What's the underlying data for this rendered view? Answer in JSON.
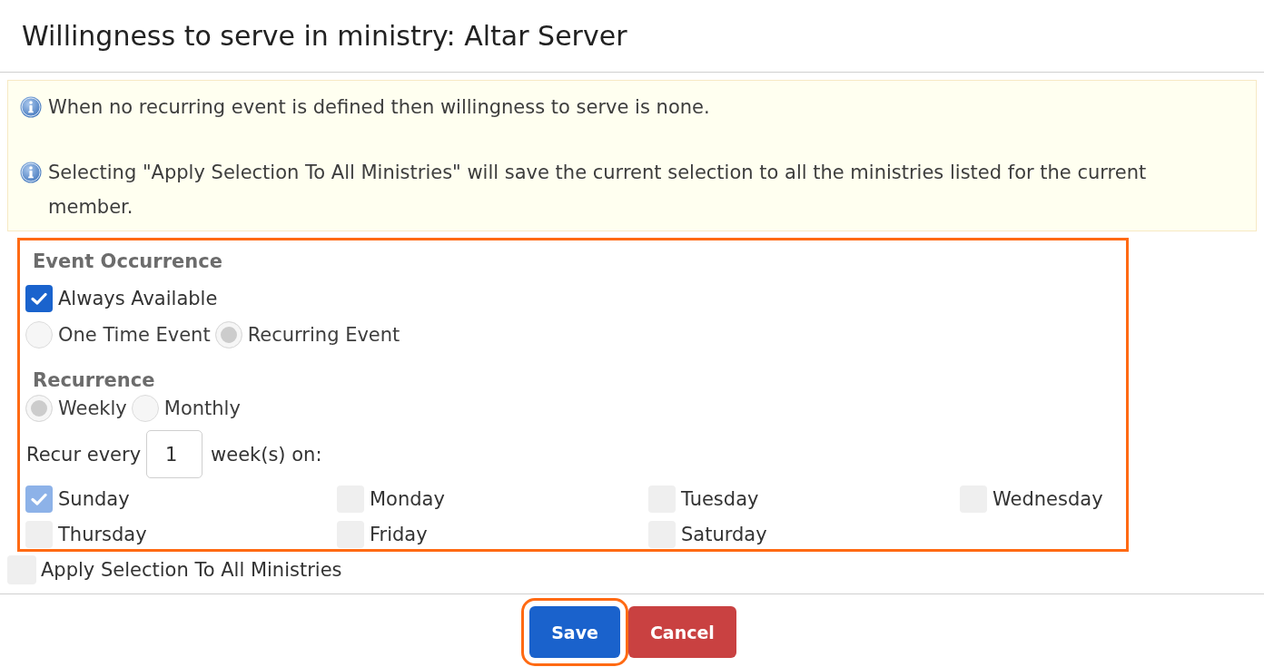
{
  "dialog": {
    "title": "Willingness to serve in ministry: Altar Server"
  },
  "notices": [
    {
      "text": "When no recurring event is defined then willingness to serve is none."
    },
    {
      "text": "Selecting \"Apply Selection To All Ministries\" will save the current selection to all the ministries listed for the current member."
    }
  ],
  "event_panel": {
    "highlighted": true,
    "occurrence": {
      "heading": "Event Occurrence",
      "always_available": {
        "label": "Always Available",
        "checked": true,
        "disabled": false
      },
      "options": [
        {
          "label": "One Time Event",
          "selected": false,
          "disabled": true
        },
        {
          "label": "Recurring Event",
          "selected": true,
          "disabled": true
        }
      ]
    },
    "recurrence": {
      "heading": "Recurrence",
      "options": [
        {
          "label": "Weekly",
          "selected": true,
          "disabled": true
        },
        {
          "label": "Monthly",
          "selected": false,
          "disabled": true
        }
      ],
      "recur_prefix": "Recur every",
      "interval": {
        "value": "1"
      },
      "recur_suffix": "week(s) on:",
      "days": [
        {
          "label": "Sunday",
          "checked": true,
          "disabled": true
        },
        {
          "label": "Monday",
          "checked": false,
          "disabled": true
        },
        {
          "label": "Tuesday",
          "checked": false,
          "disabled": true
        },
        {
          "label": "Wednesday",
          "checked": false,
          "disabled": true
        },
        {
          "label": "Thursday",
          "checked": false,
          "disabled": true
        },
        {
          "label": "Friday",
          "checked": false,
          "disabled": true
        },
        {
          "label": "Saturday",
          "checked": false,
          "disabled": true
        }
      ]
    }
  },
  "apply_all": {
    "label": "Apply Selection To All Ministries",
    "checked": false,
    "disabled": true
  },
  "buttons": [
    {
      "label": "Save",
      "kind": "primary",
      "highlighted": true
    },
    {
      "label": "Cancel",
      "kind": "danger",
      "highlighted": false
    }
  ]
}
